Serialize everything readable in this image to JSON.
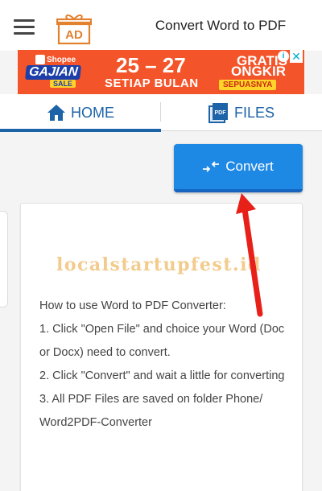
{
  "appbar": {
    "title": "Convert Word to PDF",
    "ad_icon_label": "AD",
    "menu_icon": "hamburger-menu-icon"
  },
  "banner": {
    "brand": "Shopee",
    "campaign": "GAJIAN",
    "sale": "SALE",
    "dates": "25 – 27",
    "subtitle": "SETIAP BULAN",
    "gratis": "GRATIS",
    "ongkir": "ONGKIR",
    "sepuasnya": "SEPUASNYA",
    "adchoice": "i",
    "close": "✕",
    "colors": {
      "background": "#f45429",
      "accent": "#ffd32a",
      "badge": "#1c3faa"
    }
  },
  "tabs": [
    {
      "label": "HOME",
      "icon": "home-icon",
      "active": true
    },
    {
      "label": "FILES",
      "icon": "pdf-file-icon",
      "active": false
    }
  ],
  "main": {
    "convert_label": "Convert",
    "convert_icon": "convert-arrows-icon",
    "watermark": "localstartupfest.id",
    "instructions": {
      "title": "How to use Word to PDF Converter:",
      "steps": [
        "1. Click \"Open File\" and choice your Word (Doc or Docx) need to convert.",
        "2. Click \"Convert\" and wait a little for converting",
        "3. All PDF Files are saved on folder Phone/ Word2PDF-Converter"
      ]
    }
  },
  "colors": {
    "accent": "#1d63a8",
    "button": "#1e88e5",
    "annotation_arrow": "#e8201a"
  }
}
